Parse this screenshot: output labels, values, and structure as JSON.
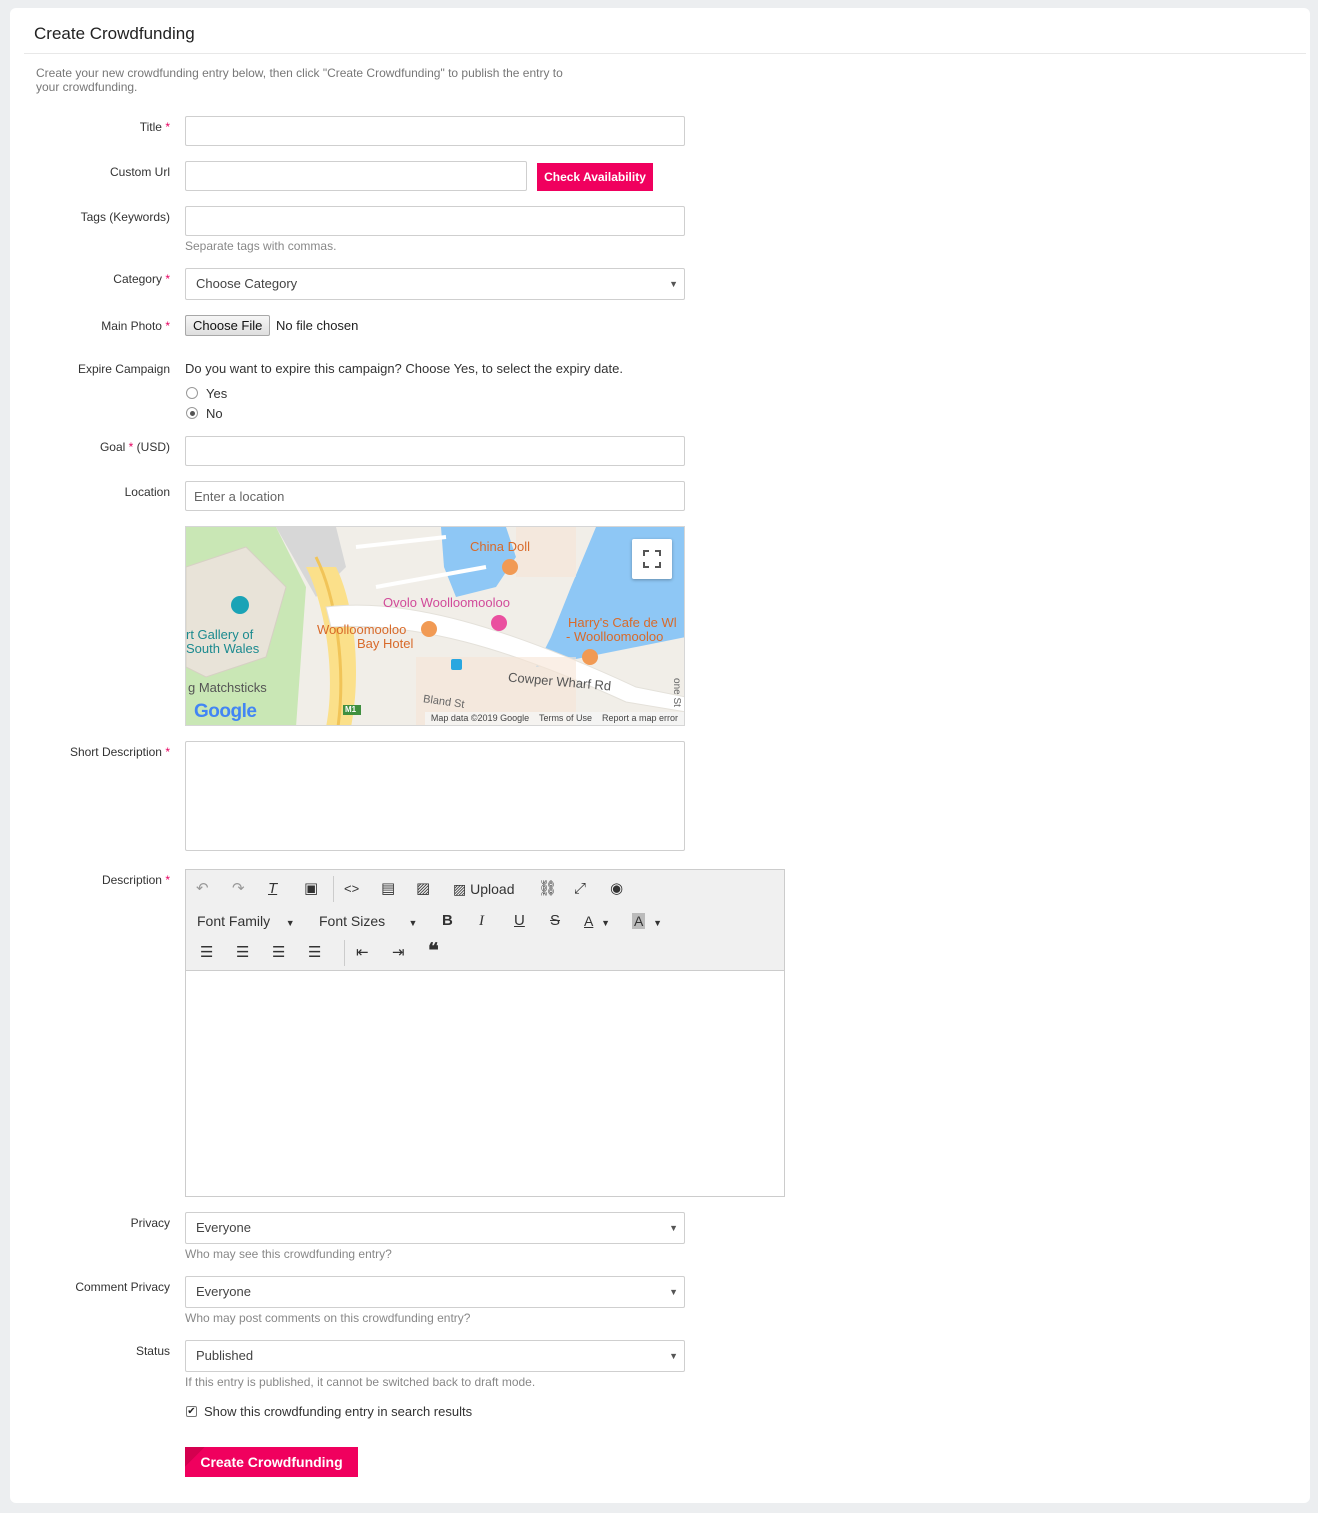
{
  "page": {
    "title": "Create Crowdfunding",
    "intro": "Create your new crowdfunding entry below, then click \"Create Crowdfunding\" to publish the entry to your crowdfunding."
  },
  "form": {
    "title_label": "Title",
    "custom_url_label": "Custom Url",
    "check_availability": "Check Availability",
    "tags_label": "Tags (Keywords)",
    "tags_help": "Separate tags with commas.",
    "category_label": "Category",
    "category_value": "Choose Category",
    "main_photo_label": "Main Photo",
    "choose_file": "Choose File",
    "no_file": "No file chosen",
    "expire_label": "Expire Campaign",
    "expire_question": "Do you want to expire this campaign? Choose Yes, to select the expiry date.",
    "expire_yes": "Yes",
    "expire_no": "No",
    "expire_selected": "No",
    "goal_label": "Goal",
    "goal_unit": "(USD)",
    "location_label": "Location",
    "location_placeholder": "Enter a location",
    "short_desc_label": "Short Description",
    "description_label": "Description",
    "privacy_label": "Privacy",
    "privacy_value": "Everyone",
    "privacy_help": "Who may see this crowdfunding entry?",
    "comment_privacy_label": "Comment Privacy",
    "comment_privacy_value": "Everyone",
    "comment_privacy_help": "Who may post comments on this crowdfunding entry?",
    "status_label": "Status",
    "status_value": "Published",
    "status_help": "If this entry is published, it cannot be switched back to draft mode.",
    "search_checkbox_label": "Show this crowdfunding entry in search results",
    "search_checked": true,
    "submit": "Create Crowdfunding"
  },
  "map": {
    "labels": {
      "china_doll": "China Doll",
      "ovolo": "Ovolo Woolloomooloo",
      "harrys_1": "Harry's Cafe de Wl",
      "harrys_2": "- Woolloomooloo",
      "art_gallery_1": "rt Gallery of",
      "art_gallery_2": "South Wales",
      "bay_hotel_1": "Woolloomooloo",
      "bay_hotel_2": "Bay Hotel",
      "cowper": "Cowper Wharf Rd",
      "matchsticks": "g Matchsticks",
      "bland": "Bland St",
      "m1": "M1",
      "one_st": "one St"
    },
    "logo": "Google",
    "footer": {
      "data": "Map data ©2019 Google",
      "terms": "Terms of Use",
      "report": "Report a map error"
    }
  },
  "editor": {
    "upload": "Upload",
    "font_family": "Font Family",
    "font_sizes": "Font Sizes",
    "icons": [
      "undo-icon",
      "redo-icon",
      "clear-format-icon",
      "paste-icon",
      "code-icon",
      "media-icon",
      "image-icon",
      "upload-icon",
      "link-icon",
      "fullscreen-icon",
      "preview-icon",
      "bold-icon",
      "italic-icon",
      "underline-icon",
      "strikethrough-icon",
      "text-color-icon",
      "background-color-icon",
      "align-left-icon",
      "align-center-icon",
      "align-right-icon",
      "align-justify-icon",
      "outdent-icon",
      "indent-icon",
      "blockquote-icon"
    ]
  },
  "colors": {
    "accent": "#f0005e",
    "required": "#e60060"
  }
}
